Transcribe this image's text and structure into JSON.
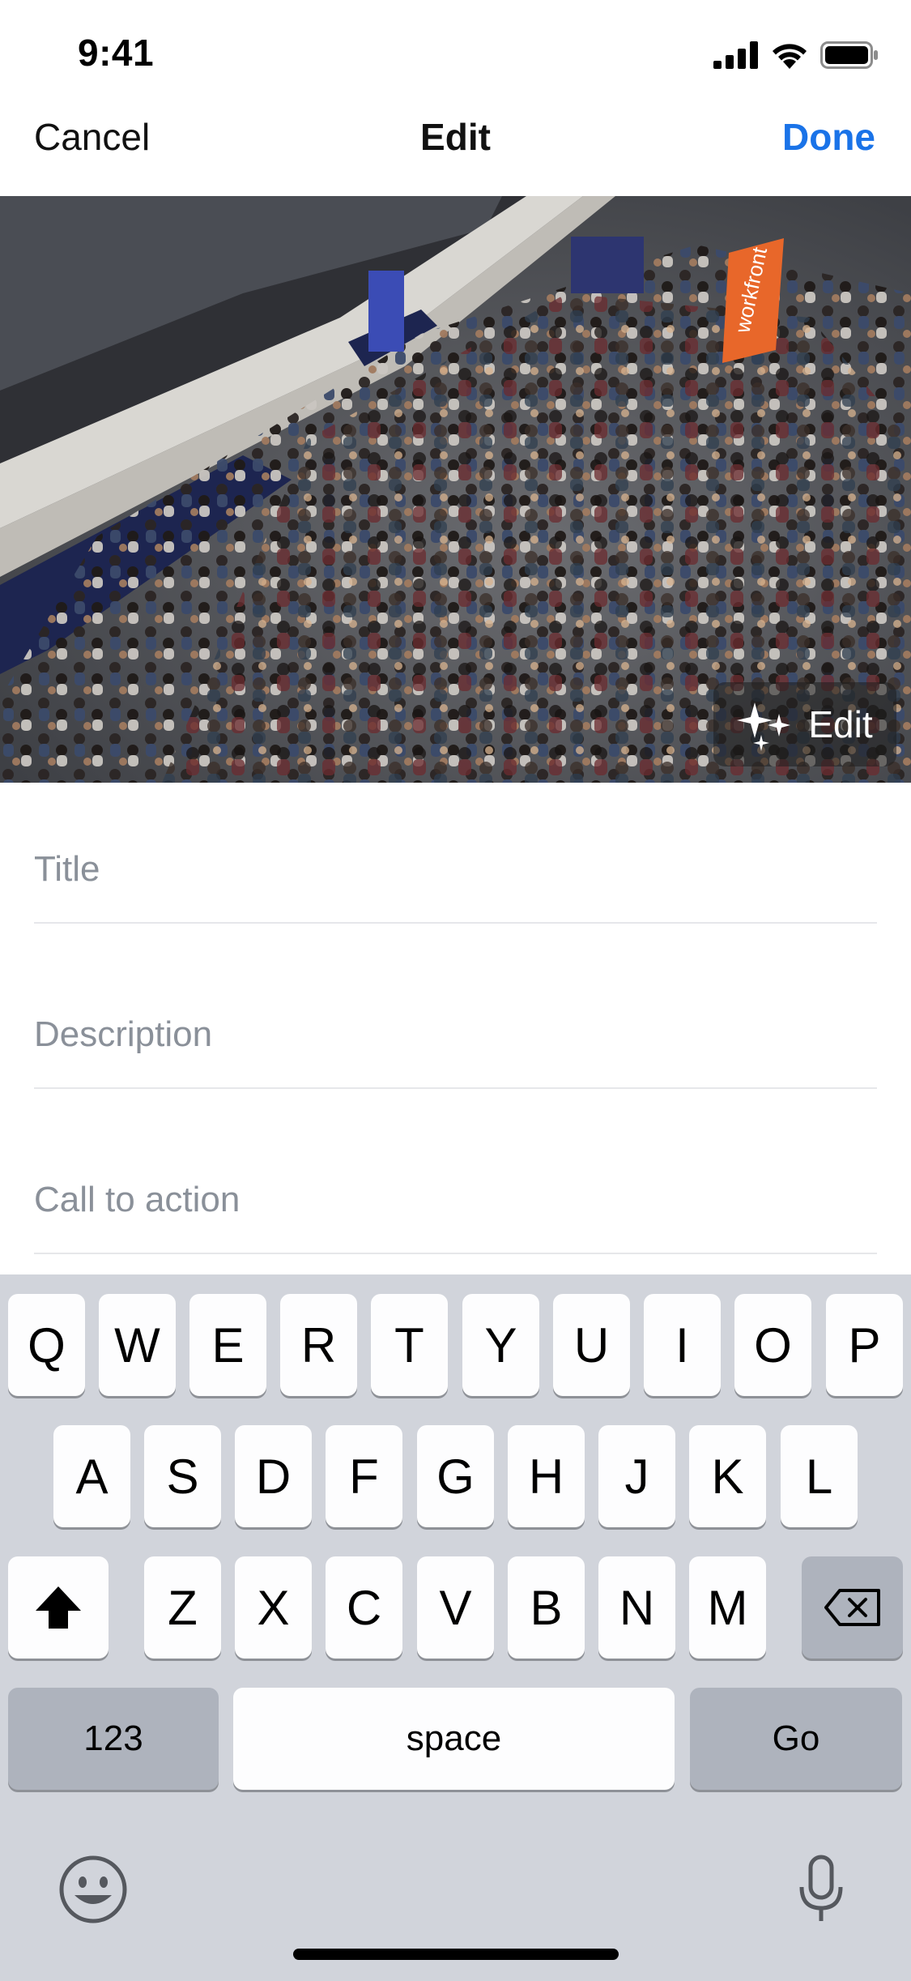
{
  "status_bar": {
    "time": "9:41"
  },
  "nav": {
    "cancel_label": "Cancel",
    "title": "Edit",
    "done_label": "Done"
  },
  "photo": {
    "edit_label": "Edit",
    "banner_text": "workfront"
  },
  "form": {
    "title_placeholder": "Title",
    "description_placeholder": "Description",
    "cta_placeholder": "Call to action"
  },
  "keyboard": {
    "row1": [
      "Q",
      "W",
      "E",
      "R",
      "T",
      "Y",
      "U",
      "I",
      "O",
      "P"
    ],
    "row2": [
      "A",
      "S",
      "D",
      "F",
      "G",
      "H",
      "J",
      "K",
      "L"
    ],
    "row3": [
      "Z",
      "X",
      "C",
      "V",
      "B",
      "N",
      "M"
    ],
    "numbers_label": "123",
    "space_label": "space",
    "go_label": "Go"
  },
  "colors": {
    "accent": "#1a73e8",
    "keyboard_bg": "#d1d4db",
    "key_dark": "#aeb3bd"
  }
}
